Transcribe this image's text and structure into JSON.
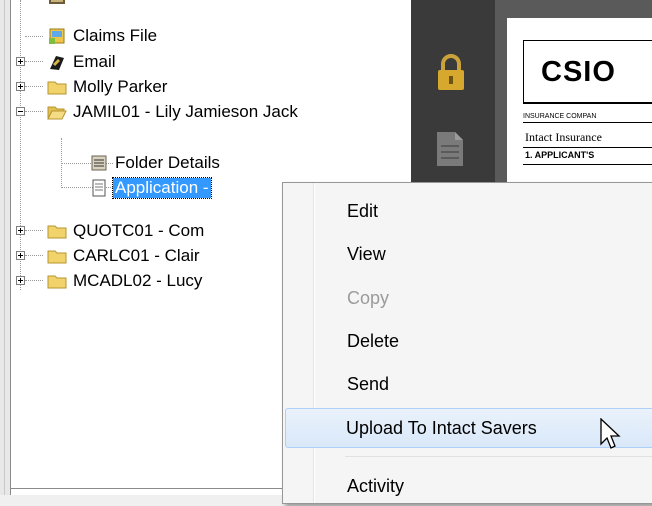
{
  "tree": {
    "items": [
      {
        "label": "Claims File"
      },
      {
        "label": "Email"
      },
      {
        "label": "Molly Parker"
      },
      {
        "label": "JAMIL01 - Lily Jamieson Jack"
      },
      {
        "label": "Folder Details"
      },
      {
        "label": "Application -"
      },
      {
        "label": "QUOTC01 - Com"
      },
      {
        "label": "CARLC01 - Clair"
      },
      {
        "label": "MCADL02 - Lucy"
      }
    ]
  },
  "document": {
    "csio": "CSIO",
    "insurance_company": "INSURANCE COMPAN",
    "insurer": "Intact Insurance",
    "applicant": "1. APPLICANT'S"
  },
  "context_menu": {
    "items": [
      {
        "label": "Edit",
        "enabled": true
      },
      {
        "label": "View",
        "enabled": true
      },
      {
        "label": "Copy",
        "enabled": false
      },
      {
        "label": "Delete",
        "enabled": true
      },
      {
        "label": "Send",
        "enabled": true
      },
      {
        "label": "Upload To Intact Savers",
        "enabled": true,
        "highlighted": true
      },
      {
        "label": "Activity",
        "enabled": true
      }
    ]
  },
  "colors": {
    "selection": "#3399ff",
    "menu_hover": "#d9e8f9",
    "dark_sidebar": "#3a3a3a",
    "folder": "#f2d36b"
  },
  "icons": [
    "lock-icon",
    "document-icon",
    "folder-icon",
    "open-folder-icon",
    "email-icon",
    "claims-file-icon",
    "folder-details-icon",
    "application-icon",
    "cursor-arrow-icon"
  ]
}
